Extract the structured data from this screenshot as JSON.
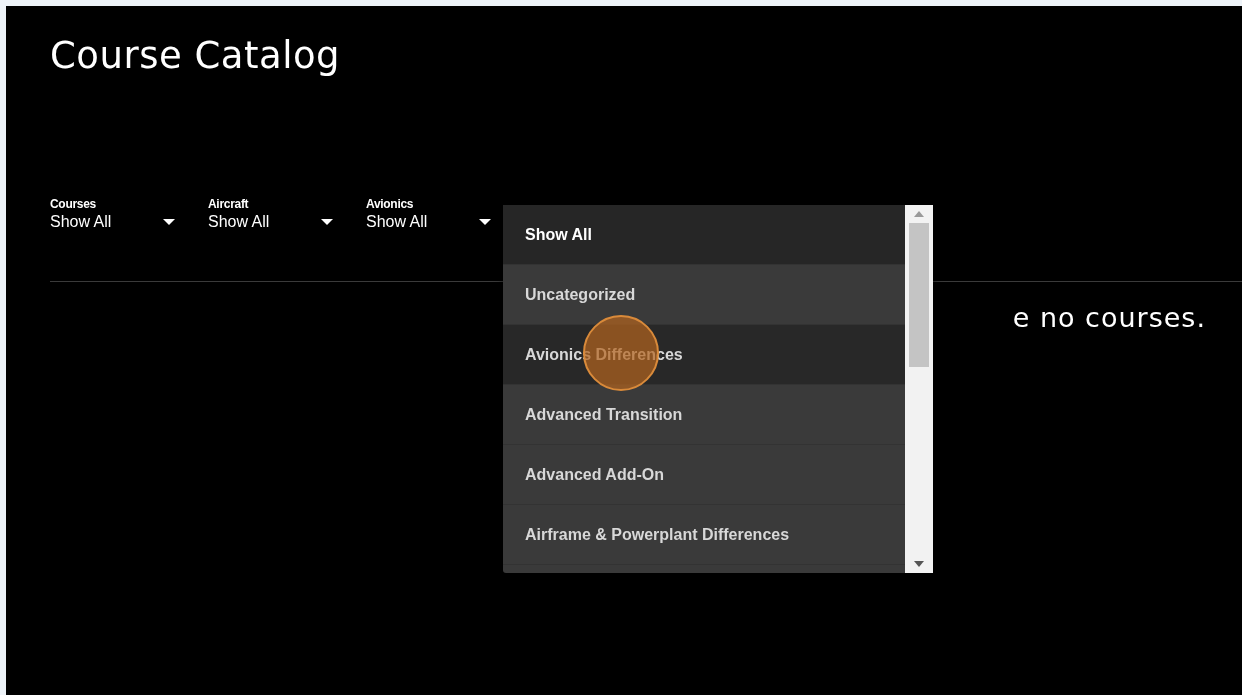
{
  "page": {
    "title": "Course Catalog"
  },
  "filters": [
    {
      "label": "Courses",
      "value": "Show All"
    },
    {
      "label": "Aircraft",
      "value": "Show All"
    },
    {
      "label": "Avionics",
      "value": "Show All"
    }
  ],
  "message": "e no courses.",
  "dropdown": {
    "options": [
      {
        "label": "Show All",
        "selected": true,
        "hovered": false
      },
      {
        "label": "Uncategorized",
        "selected": false,
        "hovered": false
      },
      {
        "label": "Avionics Differences",
        "selected": false,
        "hovered": true
      },
      {
        "label": "Advanced Transition",
        "selected": false,
        "hovered": false
      },
      {
        "label": "Advanced Add-On",
        "selected": false,
        "hovered": false
      },
      {
        "label": "Airframe & Powerplant Differences",
        "selected": false,
        "hovered": false
      }
    ]
  }
}
